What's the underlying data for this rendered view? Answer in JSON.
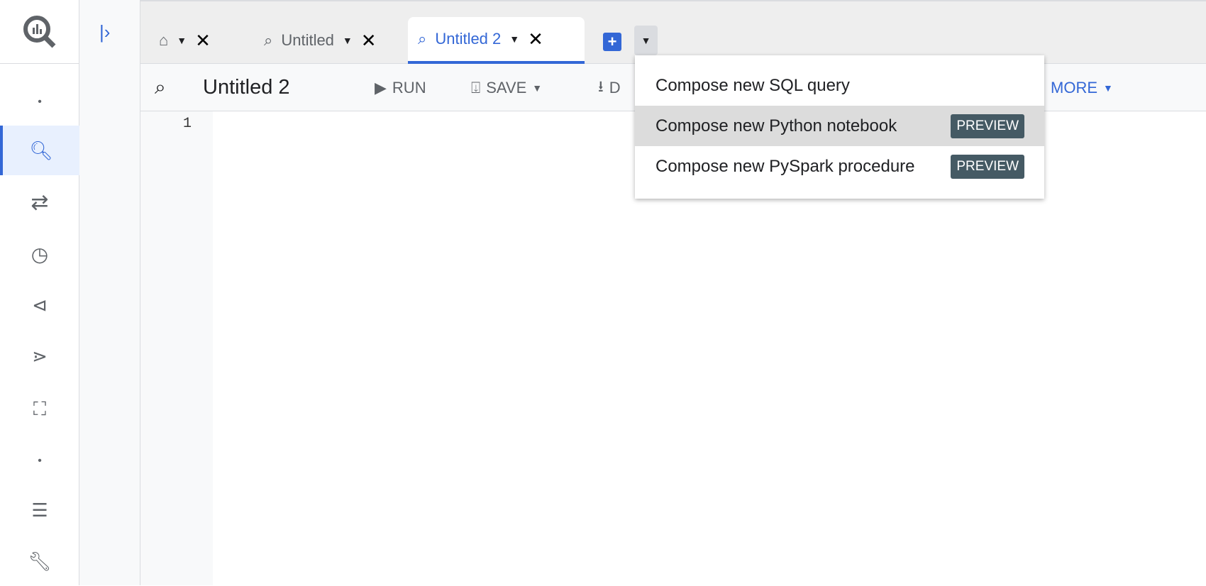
{
  "tabs": [
    {
      "label": "",
      "icon": "home-icon"
    },
    {
      "label": "Untitled",
      "icon": "bigquery-icon"
    },
    {
      "label": "Untitled 2",
      "icon": "bigquery-icon",
      "active": true
    }
  ],
  "toolbar": {
    "title": "Untitled 2",
    "run": "RUN",
    "save": "SAVE",
    "download": "D",
    "more": "MORE"
  },
  "editor": {
    "line_numbers": [
      "1"
    ]
  },
  "menu": {
    "items": [
      {
        "label": "Compose new SQL query"
      },
      {
        "label": "Compose new Python notebook",
        "badge": "PREVIEW",
        "highlighted": true
      },
      {
        "label": "Compose new PySpark procedure",
        "badge": "PREVIEW"
      }
    ]
  },
  "colors": {
    "accent": "#3367d6",
    "badge": "#455a64"
  }
}
